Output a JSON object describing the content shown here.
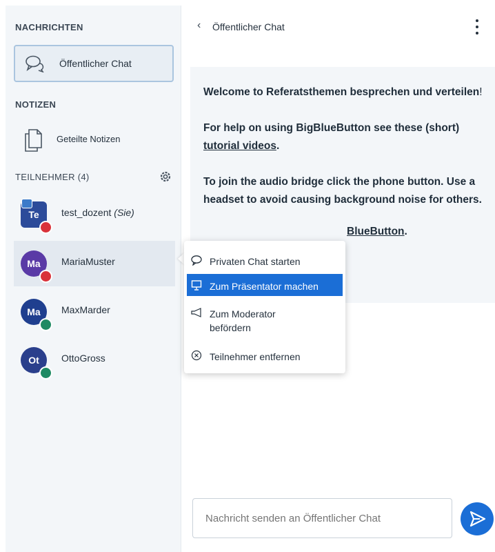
{
  "sidebar": {
    "messages_title": "NACHRICHTEN",
    "public_chat_label": "Öffentlicher Chat",
    "notes_title": "NOTIZEN",
    "shared_notes_label": "Geteilte Notizen",
    "participants_title": "TEILNEHMER (4)",
    "users": [
      {
        "initials": "Te",
        "name": "test_dozent",
        "suffix": "(Sie)",
        "color": "#2c4b9a",
        "badge": "#d9323a"
      },
      {
        "initials": "Ma",
        "name": "MariaMuster",
        "suffix": "",
        "color": "#5a3aa6",
        "badge": "#d9323a"
      },
      {
        "initials": "Ma",
        "name": "MaxMarder",
        "suffix": "",
        "color": "#1f3f8f",
        "badge": "#1f8a63"
      },
      {
        "initials": "Ot",
        "name": "OttoGross",
        "suffix": "",
        "color": "#2a3f8c",
        "badge": "#1f8a63"
      }
    ]
  },
  "header": {
    "back_icon": "‹",
    "title": "Öffentlicher Chat"
  },
  "welcome": {
    "line1_pre": "Welcome to ",
    "line1_bold": "Referatsthemen besprechen und verteilen",
    "line1_post": "!",
    "line2_pre": "For help on using BigBlueButton see these (short) ",
    "line2_link": "tutorial videos",
    "line2_post": ".",
    "line3": "To join the audio bridge click the phone button. Use a headset to avoid causing background noise for others.",
    "line4_link": "BlueButton",
    "line4_post": "."
  },
  "menu": {
    "items": [
      {
        "label": "Privaten Chat starten",
        "icon": "speech-bubble-icon"
      },
      {
        "label": "Zum Präsentator machen",
        "icon": "presentation-icon"
      },
      {
        "label": "Zum Moderator befördern",
        "icon": "megaphone-icon"
      },
      {
        "label": "Teilnehmer entfernen",
        "icon": "circle-x-icon"
      }
    ]
  },
  "composer": {
    "placeholder": "Nachricht senden an Öffentlicher Chat"
  },
  "colors": {
    "accent": "#1b6ed6",
    "sidebar_bg": "#f3f6f9"
  }
}
